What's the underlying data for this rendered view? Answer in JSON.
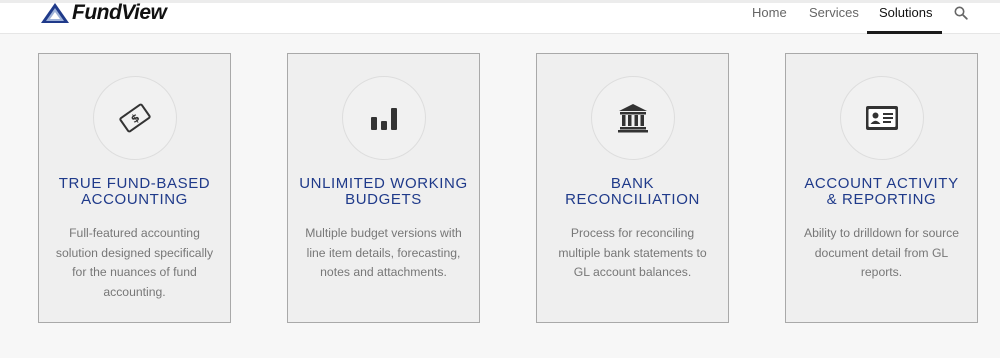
{
  "brand": {
    "name": "FundView"
  },
  "nav": {
    "items": [
      {
        "label": "Home"
      },
      {
        "label": "Services"
      },
      {
        "label": "Solutions"
      }
    ],
    "active": "Solutions",
    "search_icon": "search-icon"
  },
  "colors": {
    "accent_title": "#1f3a8a",
    "card_background": "#efefef",
    "card_border": "#a9a9a9",
    "icon_color": "#333333"
  },
  "cards": [
    {
      "icon": "money-bill-icon",
      "title_line1": "TRUE FUND-BASED",
      "title_line2": "ACCOUNTING",
      "desc_line1": "Full-featured accounting",
      "desc_line2": "solution designed specifically",
      "desc_line3": "for the nuances of fund",
      "desc_line4": "accounting."
    },
    {
      "icon": "bar-chart-icon",
      "title_line1": "UNLIMITED WORKING",
      "title_line2": "BUDGETS",
      "desc_line1": "Multiple budget versions with",
      "desc_line2": "line item details, forecasting,",
      "desc_line3": "notes and attachments."
    },
    {
      "icon": "bank-icon",
      "title_line1": "BANK",
      "title_line2": "RECONCILIATION",
      "desc_line1": "Process for reconciling",
      "desc_line2": "multiple bank statements to",
      "desc_line3": "GL account balances."
    },
    {
      "icon": "id-card-icon",
      "title_line1": "ACCOUNT ACTIVITY",
      "title_line2": "& REPORTING",
      "desc_line1": "Ability to drilldown for source",
      "desc_line2": "document detail from GL",
      "desc_line3": "reports."
    }
  ]
}
